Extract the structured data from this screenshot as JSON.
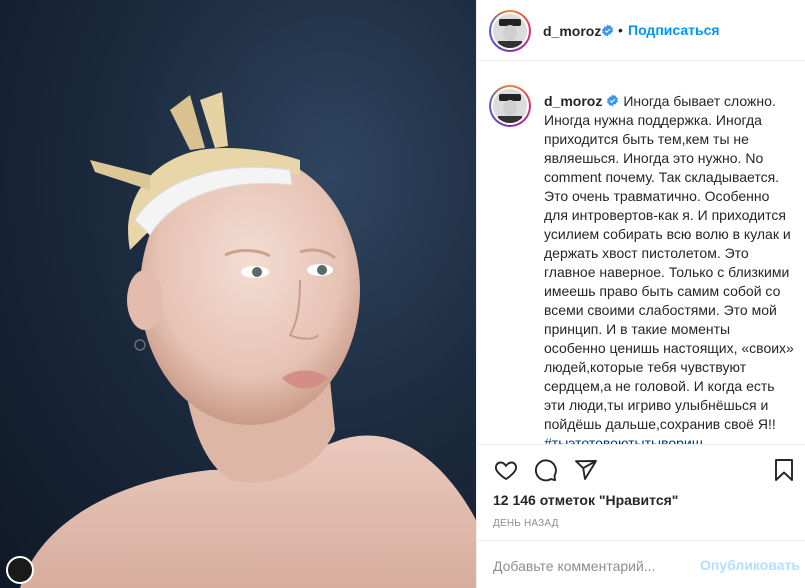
{
  "post": {
    "author": "d_moroz",
    "follow_label": "Подписаться",
    "separator": "•",
    "caption_text": "Иногда бывает сложно. Иногда нужна поддержка. Иногда приходится быть тем,кем ты не являешься. Иногда это нужно. No comment почему. Так складывается. Это очень травматично. Особенно для интровертов-как я. И приходится усилием собирать всю волю в кулак и держать хвост пистолетом. Это главное наверное. Только с близкими имеешь право быть самим собой со всеми своими слабостями. Это мой принцип. И в такие моменты особенно ценишь настоящих, «своих» людей,которые тебя чувствуют сердцем,а не головой. И когда есть эти люди,ты игриво улыбнёшься и пойдёшь дальше,сохранив своё Я!!",
    "hashtag": "#тыэтотовоютытыворищ",
    "likes": "12 146 отметок \"Нравится\"",
    "time": "ДЕНЬ НАЗАД"
  },
  "comment": {
    "placeholder": "Добавьте комментарий...",
    "publish_label": "Опубликовать"
  },
  "icons": {
    "like": "heart-icon",
    "comment": "comment-bubble-icon",
    "share": "paper-plane-icon",
    "save": "bookmark-icon",
    "verified": "verified-badge-icon"
  },
  "colors": {
    "accent": "#0095f6",
    "publish_disabled": "#b2dffc",
    "text": "#262626",
    "muted": "#8e8e8e",
    "hashtag": "#00376b",
    "photo_background": "#1c2b3f"
  }
}
